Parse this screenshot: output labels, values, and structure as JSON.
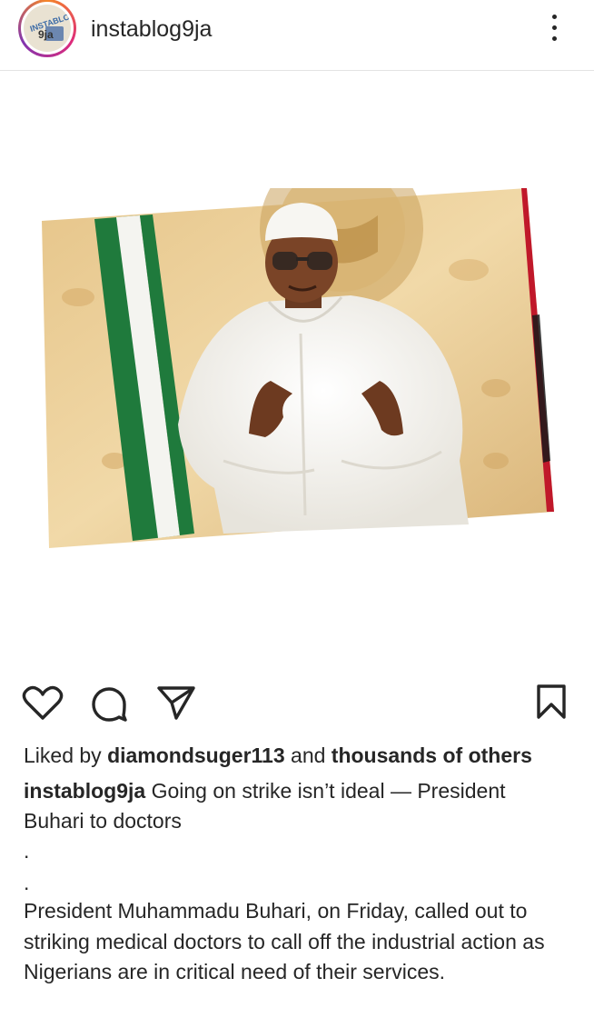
{
  "header": {
    "username": "instablog9ja",
    "avatar_text_top": "INSTABLOG",
    "avatar_text_bottom": "9ja"
  },
  "post": {
    "image_alt": "President in white attire gesturing in front of a Nigerian flag and coat of arms"
  },
  "actions": {
    "like_icon": "heart-icon",
    "comment_icon": "comment-icon",
    "share_icon": "send-icon",
    "save_icon": "bookmark-icon"
  },
  "likes": {
    "prefix": "Liked by ",
    "user": "diamondsuger113",
    "middle": " and ",
    "others": "thousands of others"
  },
  "caption": {
    "user": "instablog9ja",
    "text": " Going on strike isn’t ideal — President Buhari to doctors",
    "dot1": ".",
    "dot2": ".",
    "body": "President Muhammadu Buhari, on Friday, called out to striking medical doctors to call off the industrial action as Nigerians are in critical need of their services."
  },
  "colors": {
    "text": "#262626",
    "ring_start": "#f58529",
    "ring_end": "#8134af"
  }
}
